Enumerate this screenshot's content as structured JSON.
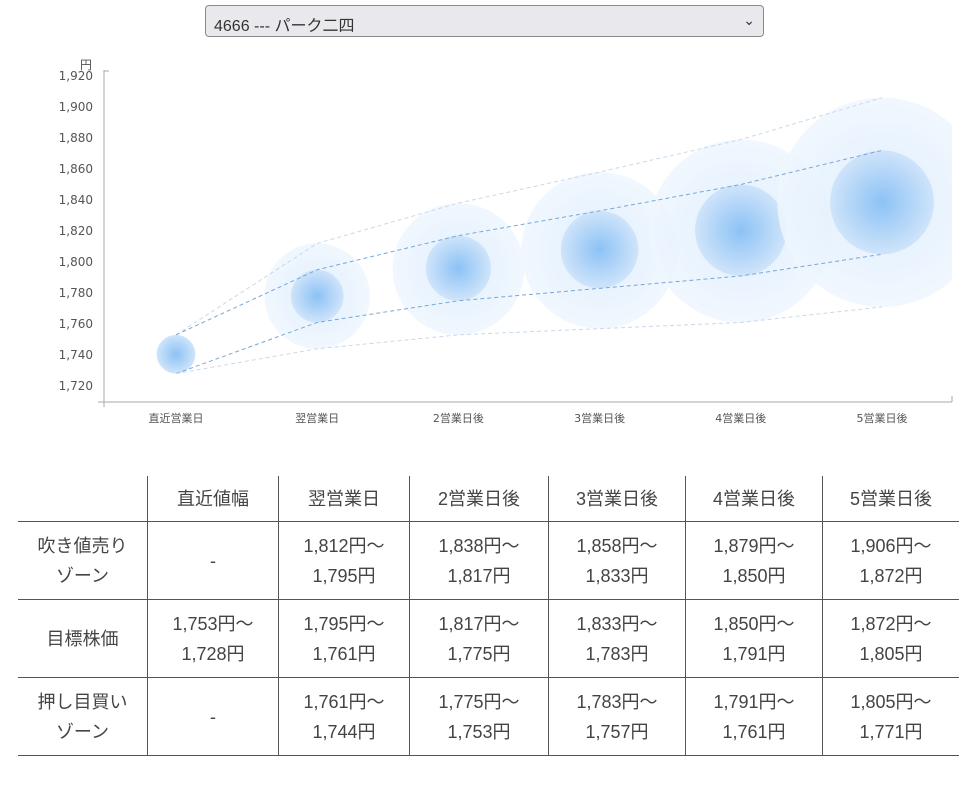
{
  "selector": {
    "value": "4666 --- パーク二四"
  },
  "chart_data": {
    "type": "bubble-range",
    "ylabel": "円",
    "ylim": [
      1710,
      1920
    ],
    "yticks": [
      "1,720",
      "1,740",
      "1,760",
      "1,780",
      "1,800",
      "1,820",
      "1,840",
      "1,860",
      "1,880",
      "1,900",
      "1,920"
    ],
    "ytick_values": [
      1720,
      1740,
      1760,
      1780,
      1800,
      1820,
      1840,
      1860,
      1880,
      1900,
      1920
    ],
    "categories": [
      "直近営業日",
      "翌営業日",
      "2営業日後",
      "3営業日後",
      "4営業日後",
      "5営業日後"
    ],
    "sell_zone_high": [
      1753,
      1812,
      1838,
      1858,
      1879,
      1906
    ],
    "target_high": [
      1753,
      1795,
      1817,
      1833,
      1850,
      1872
    ],
    "target_low": [
      1728,
      1761,
      1775,
      1783,
      1791,
      1805
    ],
    "buy_zone_low": [
      1728,
      1744,
      1753,
      1757,
      1761,
      1771
    ],
    "colors": {
      "bubble": "#4a9ef0",
      "line": "#7aa7d6"
    }
  },
  "table": {
    "headers": [
      "",
      "直近値幅",
      "翌営業日",
      "2営業日後",
      "3営業日後",
      "4営業日後",
      "5営業日後"
    ],
    "rows": [
      {
        "label": [
          "吹き値売り",
          "ゾーン"
        ],
        "cells": [
          [
            "-"
          ],
          [
            "1,812円～",
            "1,795円"
          ],
          [
            "1,838円～",
            "1,817円"
          ],
          [
            "1,858円～",
            "1,833円"
          ],
          [
            "1,879円～",
            "1,850円"
          ],
          [
            "1,906円～",
            "1,872円"
          ]
        ]
      },
      {
        "label": [
          "目標株価"
        ],
        "cells": [
          [
            "1,753円～",
            "1,728円"
          ],
          [
            "1,795円～",
            "1,761円"
          ],
          [
            "1,817円～",
            "1,775円"
          ],
          [
            "1,833円～",
            "1,783円"
          ],
          [
            "1,850円～",
            "1,791円"
          ],
          [
            "1,872円～",
            "1,805円"
          ]
        ]
      },
      {
        "label": [
          "押し目買い",
          "ゾーン"
        ],
        "cells": [
          [
            "-"
          ],
          [
            "1,761円～",
            "1,744円"
          ],
          [
            "1,775円～",
            "1,753円"
          ],
          [
            "1,783円～",
            "1,757円"
          ],
          [
            "1,791円～",
            "1,761円"
          ],
          [
            "1,805円～",
            "1,771円"
          ]
        ]
      }
    ]
  }
}
